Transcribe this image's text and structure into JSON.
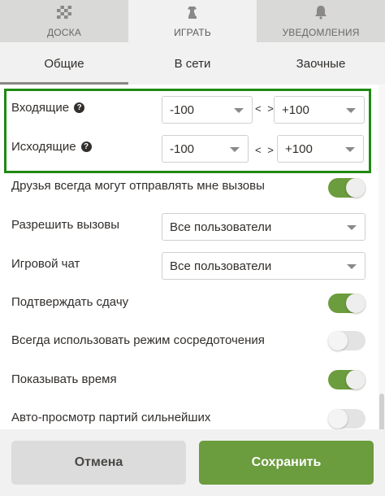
{
  "top_tabs": [
    {
      "label": "ДОСКА",
      "icon": "board-icon"
    },
    {
      "label": "ИГРАТЬ",
      "icon": "pawn-icon"
    },
    {
      "label": "УВЕДОМЛЕНИЯ",
      "icon": "bell-icon"
    }
  ],
  "sub_tabs": [
    "Общие",
    "В сети",
    "Заочные"
  ],
  "challenges": {
    "incoming": {
      "label": "Входящие",
      "min": "-100",
      "sep": "< >",
      "max": "+100"
    },
    "outgoing": {
      "label": "Исходящие",
      "min": "-100",
      "sep": "< >",
      "max": "+100"
    }
  },
  "settings": {
    "friends_challenge": {
      "label": "Друзья всегда могут отправлять мне вызовы",
      "on": true
    },
    "allow_challenges": {
      "label": "Разрешить вызовы",
      "value": "Все пользователи"
    },
    "game_chat": {
      "label": "Игровой чат",
      "value": "Все пользователи"
    },
    "confirm_resign": {
      "label": "Подтверждать сдачу",
      "on": true
    },
    "focus_mode": {
      "label": "Всегда использовать режим сосредоточения",
      "on": false
    },
    "show_time": {
      "label": "Показывать время",
      "on": true
    },
    "auto_watch": {
      "label": "Авто-просмотр партий сильнейших",
      "on": false
    }
  },
  "footer": {
    "cancel_label": "Отмена",
    "save_label": "Сохранить"
  },
  "colors": {
    "accent_green": "#6b9c3d",
    "highlight_border": "#1f8a12"
  }
}
